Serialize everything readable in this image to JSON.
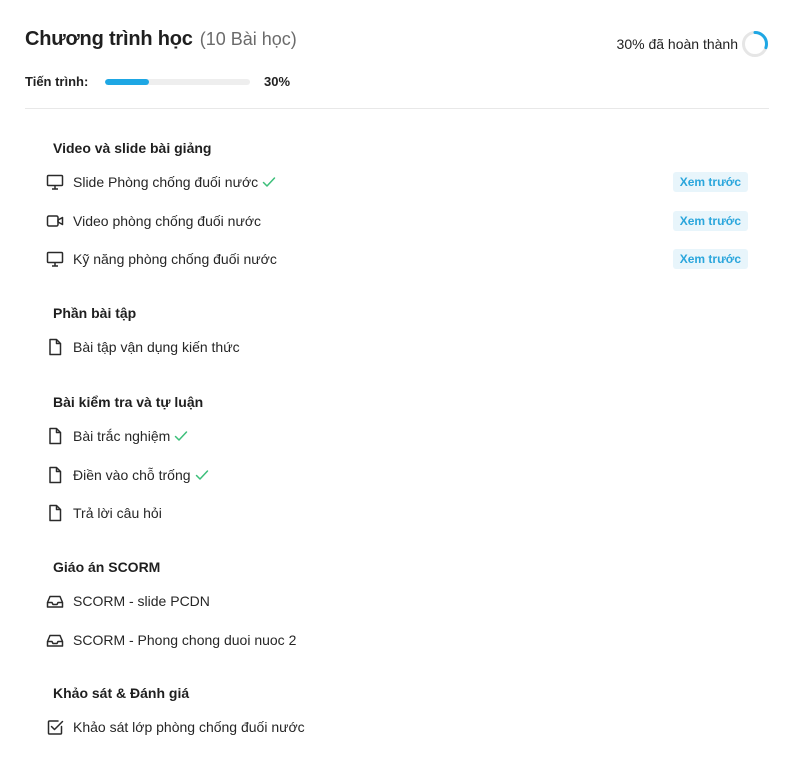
{
  "header": {
    "title": "Chương trình học",
    "count": "(10 Bài học)",
    "completion_text": "30% đã hoàn thành",
    "progress_label": "Tiến trình:",
    "progress_value": "30%",
    "progress_percent": 30
  },
  "colors": {
    "accent": "#1ea7e4",
    "check": "#3cbf7a",
    "preview_bg": "#e8f5fb",
    "preview_text": "#2aa6dc"
  },
  "sections": [
    {
      "title": "Video và slide bài giảng",
      "lessons": [
        {
          "title": "Slide Phòng chống đuối nước",
          "icon": "monitor-icon",
          "completed": true,
          "preview": "Xem trước"
        },
        {
          "title": "Video phòng chống đuối nước",
          "icon": "video-icon",
          "completed": false,
          "preview": "Xem trước"
        },
        {
          "title": "Kỹ năng phòng chống đuối nước",
          "icon": "monitor-icon",
          "completed": false,
          "preview": "Xem trước"
        }
      ]
    },
    {
      "title": "Phần bài tập",
      "lessons": [
        {
          "title": "Bài tập vận dụng kiến thức",
          "icon": "document-icon",
          "completed": false
        }
      ]
    },
    {
      "title": "Bài kiểm tra và tự luận",
      "lessons": [
        {
          "title": "Bài trắc nghiệm",
          "icon": "document-icon",
          "completed": true
        },
        {
          "title": "Điền vào chỗ trống",
          "icon": "document-icon",
          "completed": true
        },
        {
          "title": "Trả lời câu hỏi",
          "icon": "document-icon",
          "completed": false
        }
      ]
    },
    {
      "title": "Giáo án SCORM",
      "lessons": [
        {
          "title": "SCORM - slide PCDN",
          "icon": "inbox-icon",
          "completed": false
        },
        {
          "title": "SCORM - Phong chong duoi nuoc 2",
          "icon": "inbox-icon",
          "completed": false
        }
      ]
    },
    {
      "title": "Khảo sát & Đánh giá",
      "lessons": [
        {
          "title": "Khảo sát lớp phòng chống đuối nước",
          "icon": "checkbox-icon",
          "completed": false
        }
      ]
    }
  ]
}
